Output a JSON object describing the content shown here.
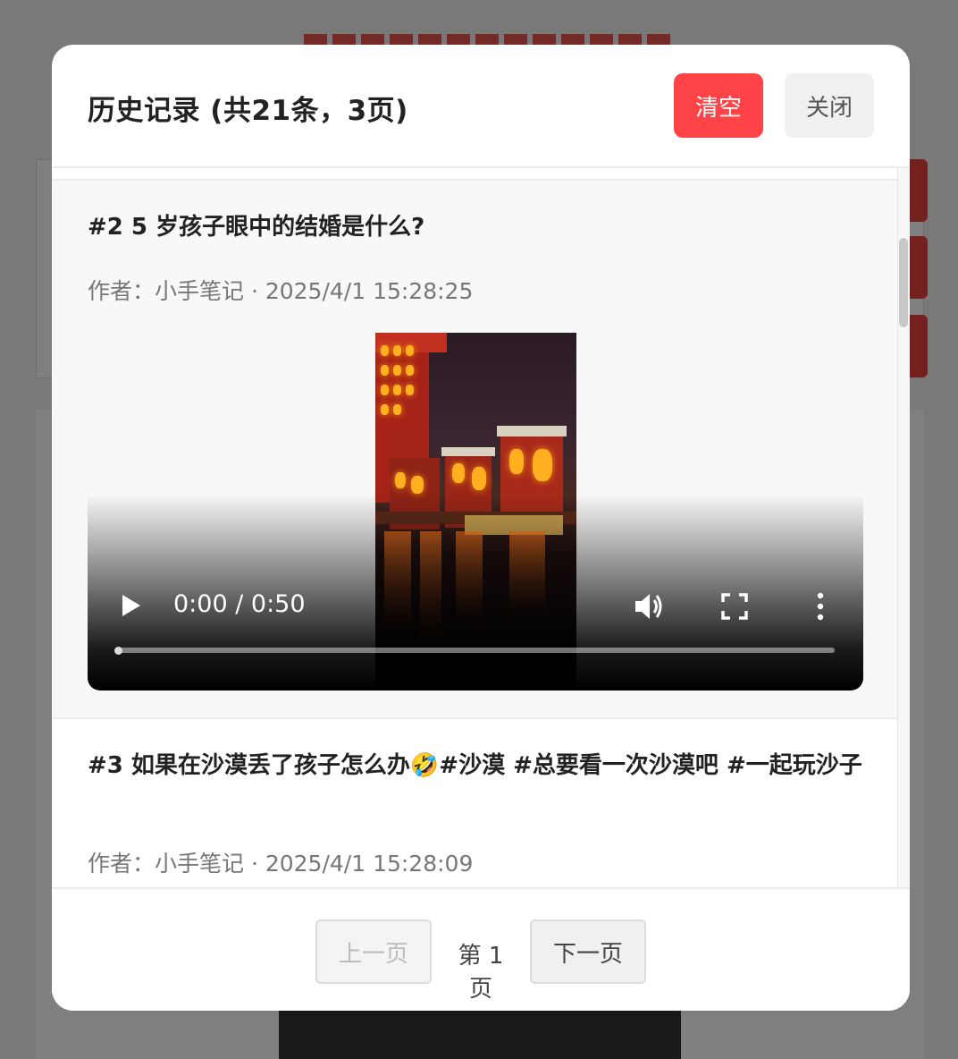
{
  "modal": {
    "title": "历史记录 (共21条，3页)",
    "clear_label": "清空",
    "close_label": "关闭"
  },
  "items": [
    {
      "title": "#2 5 岁孩子眼中的结婚是什么?",
      "meta": "作者：小手笔记 · 2025/4/1 15:28:25",
      "video": {
        "time": "0:00 / 0:50",
        "progress": 0
      }
    },
    {
      "title": "#3 如果在沙漠丢了孩子怎么办🤣#沙漠 #总要看一次沙漠吧 #一起玩沙子",
      "meta": "作者：小手笔记 · 2025/4/1 15:28:09"
    }
  ],
  "pagination": {
    "prev_label": "上一页",
    "page_label": "第 1 页",
    "next_label": "下一页"
  },
  "colors": {
    "accent": "#ff4346",
    "overlay": "rgba(0,0,0,0.5)"
  }
}
